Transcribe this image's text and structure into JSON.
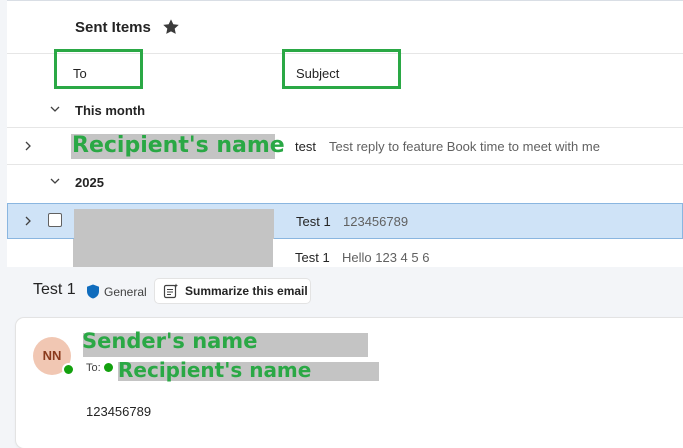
{
  "folder": {
    "title": "Sent Items",
    "favorite_icon": "star-icon"
  },
  "columns": {
    "to": "To",
    "subject": "Subject"
  },
  "groups": [
    {
      "label": "This month"
    },
    {
      "label": "2025"
    }
  ],
  "messages": [
    {
      "recipient": "Recipient's name",
      "subject": "test",
      "preview": "Test reply to feature Book time to meet with me",
      "selected": false
    },
    {
      "recipient": "",
      "subject": "Test 1",
      "preview": "123456789",
      "selected": true
    },
    {
      "recipient": "",
      "subject": "Test 1",
      "preview": "Hello 123 4 5 6",
      "selected": false
    }
  ],
  "reading_pane": {
    "subject": "Test 1",
    "sensitivity_label": "General",
    "summarize_label": "Summarize this email",
    "sender_initials": "NN",
    "sender_name": "Sender's name",
    "to_label": "To:",
    "to_name": "Recipient's name",
    "body": "123456789"
  },
  "colors": {
    "annotation_green": "#2aa845",
    "selected_row": "#cfe3f7",
    "redaction_gray": "#c4c4c4",
    "presence_green": "#13a10e",
    "avatar_bg": "#f1c7b3",
    "shield_blue": "#0f6cbd"
  }
}
